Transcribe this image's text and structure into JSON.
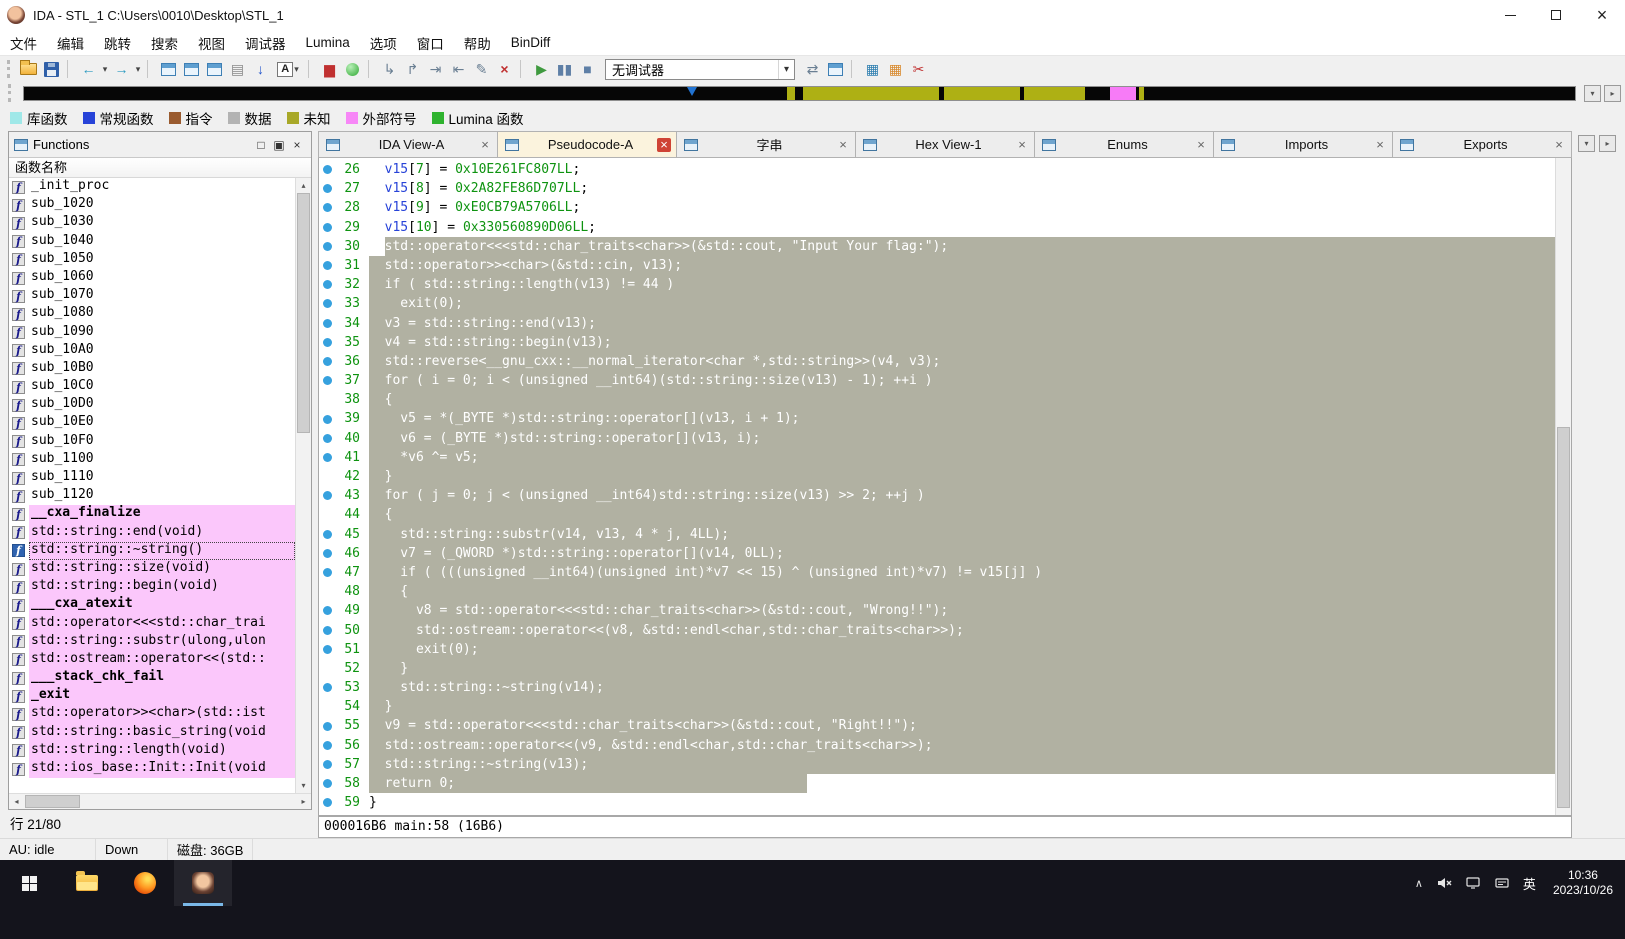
{
  "titlebar": {
    "title": "IDA - STL_1 C:\\Users\\0010\\Desktop\\STL_1"
  },
  "menu": {
    "items": [
      {
        "id": "file",
        "label": "文件"
      },
      {
        "id": "edit",
        "label": "编辑"
      },
      {
        "id": "jump",
        "label": "跳转"
      },
      {
        "id": "search",
        "label": "搜索"
      },
      {
        "id": "view",
        "label": "视图"
      },
      {
        "id": "debugger",
        "label": "调试器"
      },
      {
        "id": "lumina",
        "label": "Lumina"
      },
      {
        "id": "options",
        "label": "选项"
      },
      {
        "id": "windows",
        "label": "窗口"
      },
      {
        "id": "help",
        "label": "帮助"
      },
      {
        "id": "bindiff",
        "label": "BinDiff"
      }
    ]
  },
  "toolbar": {
    "debugger": "无调试器",
    "items": [
      {
        "k": "grip",
        "n": "toolbar-grip"
      },
      {
        "k": "folder",
        "n": "open-file-icon"
      },
      {
        "k": "floppy",
        "n": "save-file-icon"
      },
      {
        "k": "sep"
      },
      {
        "k": "g",
        "n": "navigate-back-icon",
        "g": "←",
        "c": "#2D9BC0",
        "b": 1
      },
      {
        "k": "caret",
        "n": "back-history-caret"
      },
      {
        "k": "g",
        "n": "navigate-forward-icon",
        "g": "→",
        "c": "#2D9BC0",
        "b": 1
      },
      {
        "k": "caret",
        "n": "forward-history-caret"
      },
      {
        "k": "sep"
      },
      {
        "k": "win",
        "n": "jump-by-name-icon"
      },
      {
        "k": "win",
        "n": "jump-by-address-icon"
      },
      {
        "k": "win",
        "n": "jump-xrefs-icon"
      },
      {
        "k": "g",
        "n": "print-icon",
        "g": "▤",
        "c": "#8A8A8A"
      },
      {
        "k": "g",
        "n": "jump-next-icon",
        "g": "↓",
        "c": "#2255CC",
        "b": 1
      },
      {
        "k": "abox",
        "n": "font-options-icon"
      },
      {
        "k": "sep"
      },
      {
        "k": "g",
        "n": "snapshot-icon",
        "g": "▆",
        "c": "#C03030"
      },
      {
        "k": "dot",
        "n": "lumina-icon",
        "c": "#2FA832"
      },
      {
        "k": "sep"
      },
      {
        "k": "g",
        "n": "step-into-icon",
        "g": "↳",
        "c": "#6A7F93"
      },
      {
        "k": "g",
        "n": "step-over-icon",
        "g": "↱",
        "c": "#6A7F93"
      },
      {
        "k": "g",
        "n": "run-until-return-icon",
        "g": "⇥",
        "c": "#6A7F93"
      },
      {
        "k": "g",
        "n": "run-to-cursor-icon",
        "g": "⇤",
        "c": "#6A7F93"
      },
      {
        "k": "g",
        "n": "edit-icon",
        "g": "✎",
        "c": "#6A7F93"
      },
      {
        "k": "g",
        "n": "cancel-icon",
        "g": "×",
        "c": "#C03030",
        "b": 1
      },
      {
        "k": "sep"
      },
      {
        "k": "g",
        "n": "start-process-icon",
        "g": "▶",
        "c": "#3F9A3F"
      },
      {
        "k": "g",
        "n": "pause-process-icon",
        "g": "▮▮",
        "c": "#5E7FA6"
      },
      {
        "k": "g",
        "n": "stop-process-icon",
        "g": "■",
        "c": "#5E7FA6"
      },
      {
        "k": "select",
        "n": "debugger-select"
      },
      {
        "k": "g",
        "n": "attach-process-icon",
        "g": "⇄",
        "c": "#6A7F93"
      },
      {
        "k": "win",
        "n": "debugger-windows-icon"
      },
      {
        "k": "sep"
      },
      {
        "k": "g",
        "n": "database-icon",
        "g": "▦",
        "c": "#2E7FB0"
      },
      {
        "k": "g",
        "n": "segments-icon",
        "g": "▦",
        "c": "#D88A2E"
      },
      {
        "k": "g",
        "n": "cut-icon",
        "g": "✂",
        "c": "#C03030"
      }
    ]
  },
  "navband": {
    "marker_left": 43.1,
    "base_color": "#060606",
    "segments": [
      {
        "l": 49.2,
        "w": 0.5,
        "c": "#AEB014"
      },
      {
        "l": 50.2,
        "w": 8.8,
        "c": "#AEB014"
      },
      {
        "l": 59.3,
        "w": 4.9,
        "c": "#AEB014"
      },
      {
        "l": 64.5,
        "w": 3.9,
        "c": "#AEB014"
      },
      {
        "l": 70.0,
        "w": 1.7,
        "c": "#F77BF7"
      },
      {
        "l": 71.9,
        "w": 0.3,
        "c": "#AEB014"
      }
    ]
  },
  "legend": {
    "items": [
      {
        "id": "library-function",
        "label": "库函数",
        "color": "#9FE8E8"
      },
      {
        "id": "regular-function",
        "label": "常规函数",
        "color": "#2743D8"
      },
      {
        "id": "instruction",
        "label": "指令",
        "color": "#9A5B2F"
      },
      {
        "id": "data",
        "label": "数据",
        "color": "#B3B3B3"
      },
      {
        "id": "unexplored",
        "label": "未知",
        "color": "#A8A828"
      },
      {
        "id": "external-symbol",
        "label": "外部符号",
        "color": "#F787F7"
      },
      {
        "id": "lumina-function",
        "label": "Lumina 函数",
        "color": "#2FB32F"
      }
    ]
  },
  "tabs": {
    "items": [
      {
        "id": "ida-view-a",
        "label": "IDA View-A"
      },
      {
        "id": "pseudocode-a",
        "label": "Pseudocode-A",
        "active": true
      },
      {
        "id": "strings",
        "label": "字串"
      },
      {
        "id": "hex-view-1",
        "label": "Hex View-1"
      },
      {
        "id": "enums",
        "label": "Enums"
      },
      {
        "id": "imports",
        "label": "Imports"
      },
      {
        "id": "exports",
        "label": "Exports"
      }
    ]
  },
  "functions": {
    "title": "Functions",
    "column": "函数名称",
    "status": "行 21/80",
    "icon_glyph": "f",
    "items": [
      {
        "name": "_init_proc"
      },
      {
        "name": "sub_1020"
      },
      {
        "name": "sub_1030"
      },
      {
        "name": "sub_1040"
      },
      {
        "name": "sub_1050"
      },
      {
        "name": "sub_1060"
      },
      {
        "name": "sub_1070"
      },
      {
        "name": "sub_1080"
      },
      {
        "name": "sub_1090"
      },
      {
        "name": "sub_10A0"
      },
      {
        "name": "sub_10B0"
      },
      {
        "name": "sub_10C0"
      },
      {
        "name": "sub_10D0"
      },
      {
        "name": "sub_10E0"
      },
      {
        "name": "sub_10F0"
      },
      {
        "name": "sub_1100"
      },
      {
        "name": "sub_1110"
      },
      {
        "name": "sub_1120"
      },
      {
        "name": "__cxa_finalize",
        "lib": true,
        "bold": true
      },
      {
        "name": "std::string::end(void)",
        "lib": true
      },
      {
        "name": "std::string::~string()",
        "lib": true,
        "selected": true
      },
      {
        "name": "std::string::size(void)",
        "lib": true
      },
      {
        "name": "std::string::begin(void)",
        "lib": true
      },
      {
        "name": "___cxa_atexit",
        "lib": true,
        "bold": true
      },
      {
        "name": "std::operator<<<std::char_trai",
        "lib": true
      },
      {
        "name": "std::string::substr(ulong,ulon",
        "lib": true
      },
      {
        "name": "std::ostream::operator<<(std::",
        "lib": true
      },
      {
        "name": "___stack_chk_fail",
        "lib": true,
        "bold": true
      },
      {
        "name": "_exit",
        "lib": true,
        "bold": true
      },
      {
        "name": "std::operator>><char>(std::ist",
        "lib": true
      },
      {
        "name": "std::string::basic_string(void",
        "lib": true
      },
      {
        "name": "std::string::length(void)",
        "lib": true
      },
      {
        "name": "std::ios_base::Init::Init(void",
        "lib": true
      }
    ]
  },
  "pseudocode": {
    "status": "000016B6 main:58 (16B6)",
    "selection_color": "#B1B1A2",
    "lines": [
      {
        "n": 26,
        "dot": 1,
        "sel": 0,
        "seg": [
          [
            "  ",
            ""
          ],
          [
            "v15",
            "v"
          ],
          [
            "[",
            ""
          ],
          [
            "7",
            "n"
          ],
          [
            "]",
            ""
          ],
          [
            " = ",
            ""
          ],
          [
            "0x10E261FC807LL",
            "n"
          ],
          [
            ";",
            ""
          ]
        ]
      },
      {
        "n": 27,
        "dot": 1,
        "sel": 0,
        "seg": [
          [
            "  ",
            ""
          ],
          [
            "v15",
            "v"
          ],
          [
            "[",
            ""
          ],
          [
            "8",
            "n"
          ],
          [
            "]",
            ""
          ],
          [
            " = ",
            ""
          ],
          [
            "0x2A82FE86D707LL",
            "n"
          ],
          [
            ";",
            ""
          ]
        ]
      },
      {
        "n": 28,
        "dot": 1,
        "sel": 0,
        "seg": [
          [
            "  ",
            ""
          ],
          [
            "v15",
            "v"
          ],
          [
            "[",
            ""
          ],
          [
            "9",
            "n"
          ],
          [
            "]",
            ""
          ],
          [
            " = ",
            ""
          ],
          [
            "0xE0CB79A5706LL",
            "n"
          ],
          [
            ";",
            ""
          ]
        ]
      },
      {
        "n": 29,
        "dot": 1,
        "sel": 0,
        "seg": [
          [
            "  ",
            ""
          ],
          [
            "v15",
            "v"
          ],
          [
            "[",
            ""
          ],
          [
            "10",
            "n"
          ],
          [
            "]",
            ""
          ],
          [
            " = ",
            ""
          ],
          [
            "0x330560890D06LL",
            "n"
          ],
          [
            ";",
            ""
          ]
        ]
      },
      {
        "n": 30,
        "dot": 1,
        "sel": 1,
        "ss": 2,
        "seg": [
          [
            "  std::operator<<<std::char_traits<char>>(&std::cout, \"Input Your flag:\");",
            ""
          ]
        ]
      },
      {
        "n": 31,
        "dot": 1,
        "sel": 1,
        "seg": [
          [
            "  std::operator>><char>(&std::cin, v13);",
            ""
          ]
        ]
      },
      {
        "n": 32,
        "dot": 1,
        "sel": 1,
        "seg": [
          [
            "  if ( std::string::length(v13) != 44 )",
            ""
          ]
        ]
      },
      {
        "n": 33,
        "dot": 1,
        "sel": 1,
        "seg": [
          [
            "    exit(0);",
            ""
          ]
        ]
      },
      {
        "n": 34,
        "dot": 1,
        "sel": 1,
        "seg": [
          [
            "  v3 = std::string::end(v13);",
            ""
          ]
        ]
      },
      {
        "n": 35,
        "dot": 1,
        "sel": 1,
        "seg": [
          [
            "  v4 = std::string::begin(v13);",
            ""
          ]
        ]
      },
      {
        "n": 36,
        "dot": 1,
        "sel": 1,
        "seg": [
          [
            "  std::reverse<__gnu_cxx::__normal_iterator<char *,std::string>>(v4, v3);",
            ""
          ]
        ]
      },
      {
        "n": 37,
        "dot": 1,
        "sel": 1,
        "seg": [
          [
            "  for ( i = 0; i < (unsigned __int64)(std::string::size(v13) - 1); ++i )",
            ""
          ]
        ]
      },
      {
        "n": 38,
        "dot": 0,
        "sel": 1,
        "seg": [
          [
            "  {",
            ""
          ]
        ]
      },
      {
        "n": 39,
        "dot": 1,
        "sel": 1,
        "seg": [
          [
            "    v5 = *(_BYTE *)std::string::operator[](v13, i + 1);",
            ""
          ]
        ]
      },
      {
        "n": 40,
        "dot": 1,
        "sel": 1,
        "seg": [
          [
            "    v6 = (_BYTE *)std::string::operator[](v13, i);",
            ""
          ]
        ]
      },
      {
        "n": 41,
        "dot": 1,
        "sel": 1,
        "seg": [
          [
            "    *v6 ^= v5;",
            ""
          ]
        ]
      },
      {
        "n": 42,
        "dot": 0,
        "sel": 1,
        "seg": [
          [
            "  }",
            ""
          ]
        ]
      },
      {
        "n": 43,
        "dot": 1,
        "sel": 1,
        "seg": [
          [
            "  for ( j = 0; j < (unsigned __int64)std::string::size(v13) >> 2; ++j )",
            ""
          ]
        ]
      },
      {
        "n": 44,
        "dot": 0,
        "sel": 1,
        "seg": [
          [
            "  {",
            ""
          ]
        ]
      },
      {
        "n": 45,
        "dot": 1,
        "sel": 1,
        "seg": [
          [
            "    std::string::substr(v14, v13, 4 * j, 4LL);",
            ""
          ]
        ]
      },
      {
        "n": 46,
        "dot": 1,
        "sel": 1,
        "seg": [
          [
            "    v7 = (_QWORD *)std::string::operator[](v14, 0LL);",
            ""
          ]
        ]
      },
      {
        "n": 47,
        "dot": 1,
        "sel": 1,
        "seg": [
          [
            "    if ( (((unsigned __int64)(unsigned int)*v7 << 15) ^ (unsigned int)*v7) != v15[j] )",
            ""
          ]
        ]
      },
      {
        "n": 48,
        "dot": 0,
        "sel": 1,
        "seg": [
          [
            "    {",
            ""
          ]
        ]
      },
      {
        "n": 49,
        "dot": 1,
        "sel": 1,
        "seg": [
          [
            "      v8 = std::operator<<<std::char_traits<char>>(&std::cout, \"Wrong!!\");",
            ""
          ]
        ]
      },
      {
        "n": 50,
        "dot": 1,
        "sel": 1,
        "seg": [
          [
            "      std::ostream::operator<<(v8, &std::endl<char,std::char_traits<char>>);",
            ""
          ]
        ]
      },
      {
        "n": 51,
        "dot": 1,
        "sel": 1,
        "seg": [
          [
            "      exit(0);",
            ""
          ]
        ]
      },
      {
        "n": 52,
        "dot": 0,
        "sel": 1,
        "seg": [
          [
            "    }",
            ""
          ]
        ]
      },
      {
        "n": 53,
        "dot": 1,
        "sel": 1,
        "seg": [
          [
            "    std::string::~string(v14);",
            ""
          ]
        ]
      },
      {
        "n": 54,
        "dot": 0,
        "sel": 1,
        "seg": [
          [
            "  }",
            ""
          ]
        ]
      },
      {
        "n": 55,
        "dot": 1,
        "sel": 1,
        "seg": [
          [
            "  v9 = std::operator<<<std::char_traits<char>>(&std::cout, \"Right!!\");",
            ""
          ]
        ]
      },
      {
        "n": 56,
        "dot": 1,
        "sel": 1,
        "seg": [
          [
            "  std::ostream::operator<<(v9, &std::endl<char,std::char_traits<char>>);",
            ""
          ]
        ]
      },
      {
        "n": 57,
        "dot": 1,
        "sel": 1,
        "seg": [
          [
            "  std::string::~string(v13);",
            ""
          ]
        ]
      },
      {
        "n": 58,
        "dot": 1,
        "sel": 2,
        "seg": [
          [
            "  return 0;",
            ""
          ]
        ]
      },
      {
        "n": 59,
        "dot": 1,
        "sel": 0,
        "seg": [
          [
            "}",
            ""
          ]
        ]
      }
    ]
  },
  "statusbar": {
    "au": "AU: idle",
    "mode": "Down",
    "disk": "磁盘: 36GB"
  },
  "taskbar": {
    "time": "10:36",
    "date": "2023/10/26",
    "lang": "英"
  }
}
